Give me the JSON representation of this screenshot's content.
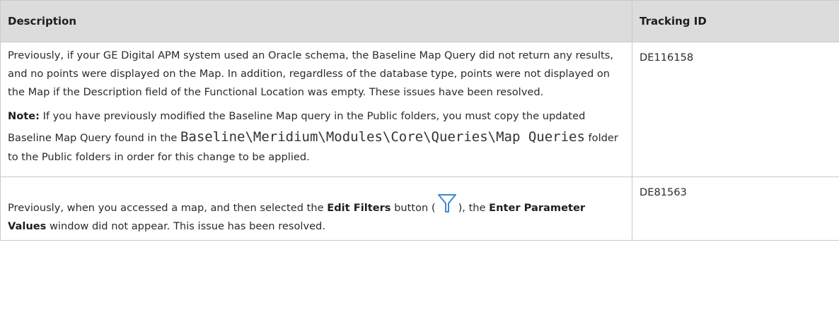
{
  "table": {
    "headers": {
      "description": "Description",
      "tracking_id": "Tracking ID"
    },
    "rows": [
      {
        "description": "Previously, if your GE Digital APM system used an Oracle schema, the Baseline Map Query did not return any results, and no points were displayed on the Map. In addition, regardless of the database type, points were not displayed on the Map if the Description field of the Functional Location was empty. These issues have been resolved.",
        "note_label": "Note:",
        "note_before": " If you have previously modified the Baseline Map query in the Public folders, you must copy the updated Baseline Map Query found in the ",
        "note_path": "Baseline\\Meridium\\Modules\\Core\\Queries\\Map Queries",
        "note_after": " folder to the Public folders in order for this change to be applied.",
        "tracking_id": "DE116158"
      },
      {
        "text_before": "Previously, when you accessed a map, and then selected the ",
        "bold1": "Edit Filters",
        "text_mid": " button (",
        "text_mid2": "), the ",
        "bold2": "Enter Parameter Values",
        "text_after": " window did not appear. This issue has been resolved.",
        "icon": "filter-icon",
        "icon_color": "#3b8bd0",
        "tracking_id": "DE81563"
      }
    ]
  }
}
